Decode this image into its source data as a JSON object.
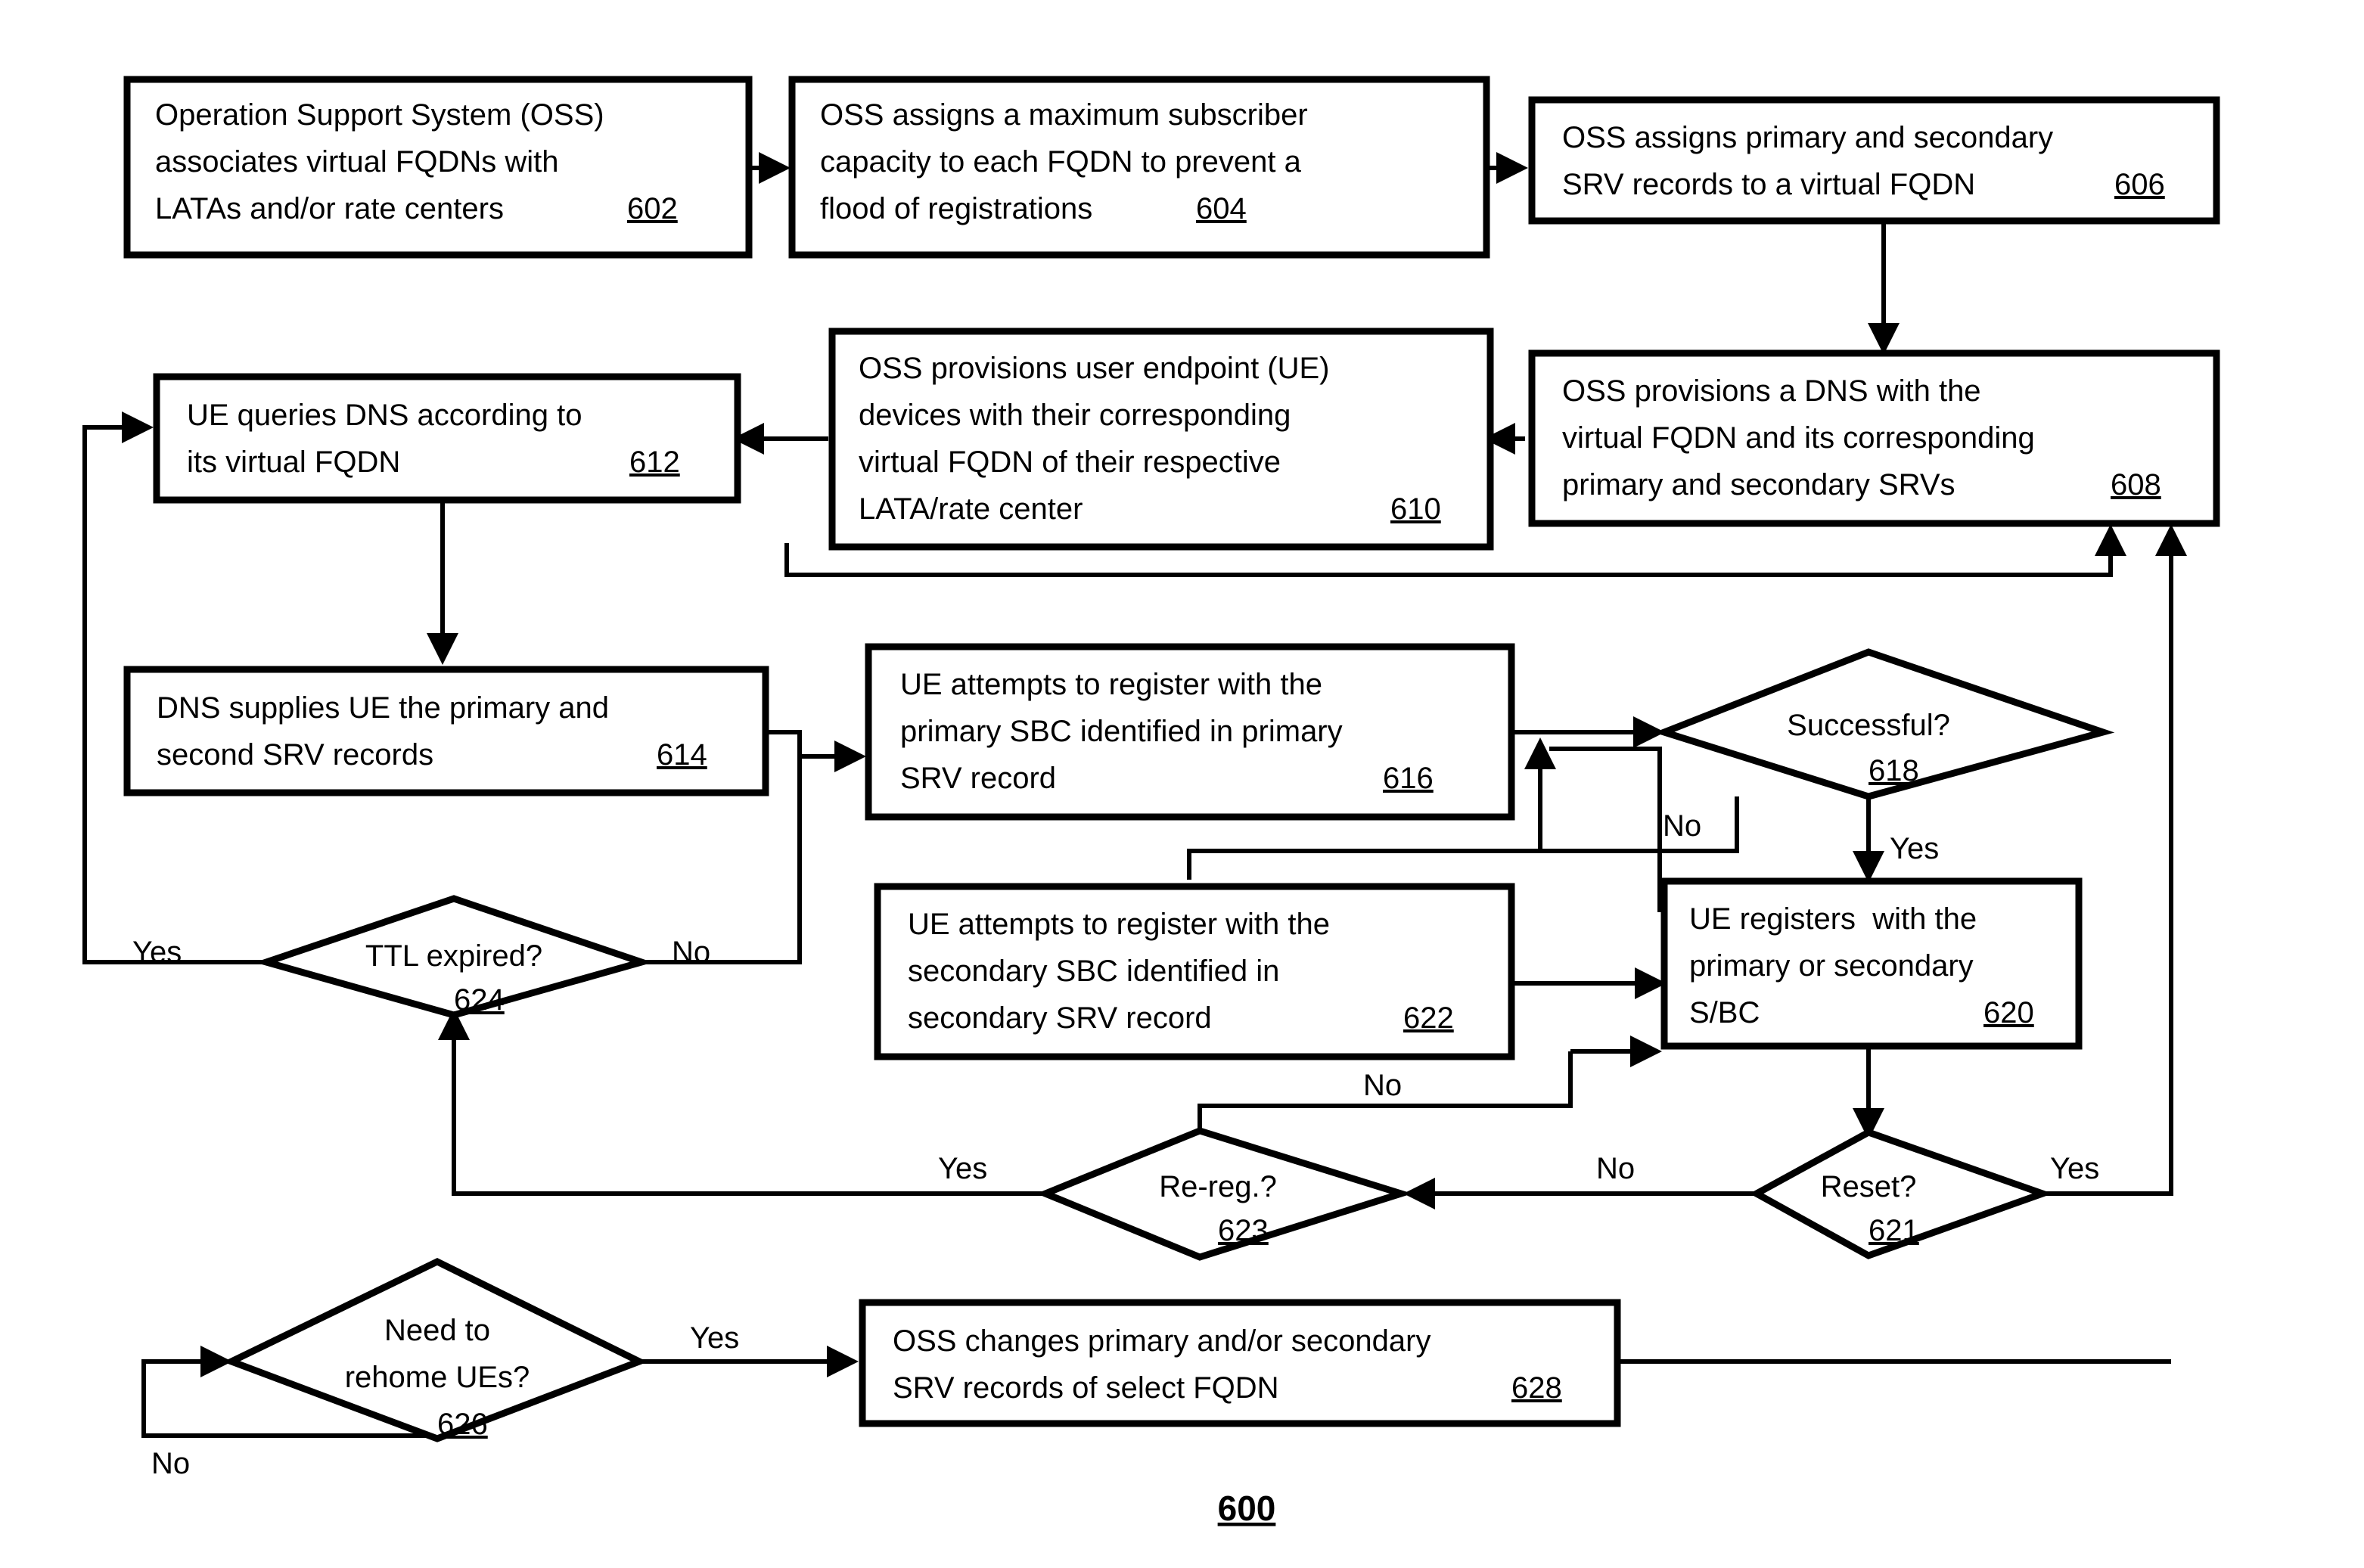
{
  "figure": {
    "label": "600",
    "type": "flowchart",
    "background_color": "#ffffff",
    "line_color": "#000000"
  },
  "nodes": {
    "n602": {
      "shape": "process",
      "ref": "602",
      "lines": [
        "Operation Support System (OSS)",
        "associates virtual FQDNs with",
        "LATAs and/or rate centers"
      ]
    },
    "n604": {
      "shape": "process",
      "ref": "604",
      "lines": [
        "OSS assigns a maximum subscriber",
        "capacity to each FQDN to prevent a",
        "flood of registrations"
      ]
    },
    "n606": {
      "shape": "process",
      "ref": "606",
      "lines": [
        "OSS assigns primary and secondary",
        "SRV records to a virtual FQDN"
      ]
    },
    "n608": {
      "shape": "process",
      "ref": "608",
      "lines": [
        "OSS provisions a DNS with the",
        "virtual FQDN and its corresponding",
        "primary and secondary SRVs"
      ]
    },
    "n610": {
      "shape": "process",
      "ref": "610",
      "lines": [
        "OSS provisions user endpoint (UE)",
        "devices with their corresponding",
        "virtual FQDN of their respective",
        "LATA/rate center"
      ]
    },
    "n612": {
      "shape": "process",
      "ref": "612",
      "lines": [
        "UE queries DNS according to",
        "its virtual FQDN"
      ]
    },
    "n614": {
      "shape": "process",
      "ref": "614",
      "lines": [
        "DNS supplies UE the primary and",
        "second SRV records"
      ]
    },
    "n616": {
      "shape": "process",
      "ref": "616",
      "lines": [
        "UE attempts to register with the",
        "primary SBC identified in primary",
        "SRV record"
      ]
    },
    "n618": {
      "shape": "decision",
      "ref": "618",
      "lines": [
        "Successful?"
      ]
    },
    "n620": {
      "shape": "process",
      "ref": "620",
      "lines": [
        "UE registers  with the",
        "primary or secondary",
        "S/BC"
      ]
    },
    "n621": {
      "shape": "decision",
      "ref": "621",
      "lines": [
        "Reset?"
      ]
    },
    "n622": {
      "shape": "process",
      "ref": "622",
      "lines": [
        "UE attempts to register with the",
        "secondary SBC identified in",
        "secondary SRV record"
      ]
    },
    "n623": {
      "shape": "decision",
      "ref": "623",
      "lines": [
        "Re-reg.?"
      ]
    },
    "n624": {
      "shape": "decision",
      "ref": "624",
      "lines": [
        "TTL expired?"
      ]
    },
    "n626": {
      "shape": "decision",
      "ref": "626",
      "lines": [
        "Need to",
        "rehome UEs?"
      ]
    },
    "n628": {
      "shape": "process",
      "ref": "628",
      "lines": [
        "OSS changes primary and/or secondary",
        "SRV records of select FQDN"
      ]
    }
  },
  "edge_labels": {
    "e618_no": "No",
    "e618_yes": "Yes",
    "e621_no": "No",
    "e621_yes": "Yes",
    "e623_yes": "Yes",
    "e623_no": "No",
    "e624_yes": "Yes",
    "e624_no": "No",
    "e626_yes": "Yes",
    "e626_no": "No"
  }
}
